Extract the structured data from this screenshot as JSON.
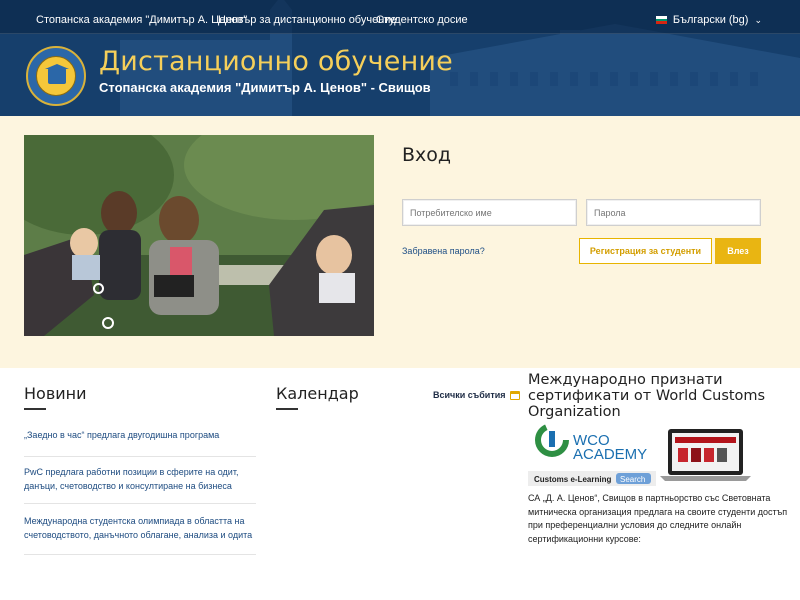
{
  "topnav": {
    "links": [
      "Стопанска академия \"Димитър А. Ценов\"",
      "Център за дистанционно обучение",
      "Студентско досие"
    ],
    "language": "Български (bg)"
  },
  "header": {
    "title": "Дистанционно обучение",
    "subtitle": "Стопанска академия \"Димитър А. Ценов\" - Свищов"
  },
  "login": {
    "title": "Вход",
    "username_placeholder": "Потребителско име",
    "password_placeholder": "Парола",
    "forgot": "Забравена парола?",
    "register_label": "Регистрация за студенти",
    "login_label": "Влез"
  },
  "news": {
    "title": "Новини",
    "items": [
      "„Заедно в час“ предлага двугодишна програма",
      "PwC предлага работни позиции в сферите на  одит, данъци, счетоводство и консултиране на бизнеса",
      "Международна студентска олимпиада в областта на счетоводството, данъчното облагане, анализа и одита"
    ]
  },
  "calendar": {
    "title": "Календар",
    "all_events": "Всички събития"
  },
  "wco": {
    "title": "Международно признати сертификати от World Customs Organization",
    "brand_line1": "WCO",
    "brand_line2": "ACADEMY",
    "banner_caption": "Customs e-Learning",
    "search_label": "Search",
    "text": "СА „Д. А. Ценов“, Свищов в партньорство със Световната митническа организация предлага на своите студенти достъп при преференциални условия до следните онлайн сертификационни курсове:"
  },
  "colors": {
    "header_blue": "#17426f",
    "title_gold": "#f5cf5a",
    "accent_yellow": "#e9b512",
    "band_cream": "#fdf5df",
    "link_blue": "#1d4b80"
  }
}
